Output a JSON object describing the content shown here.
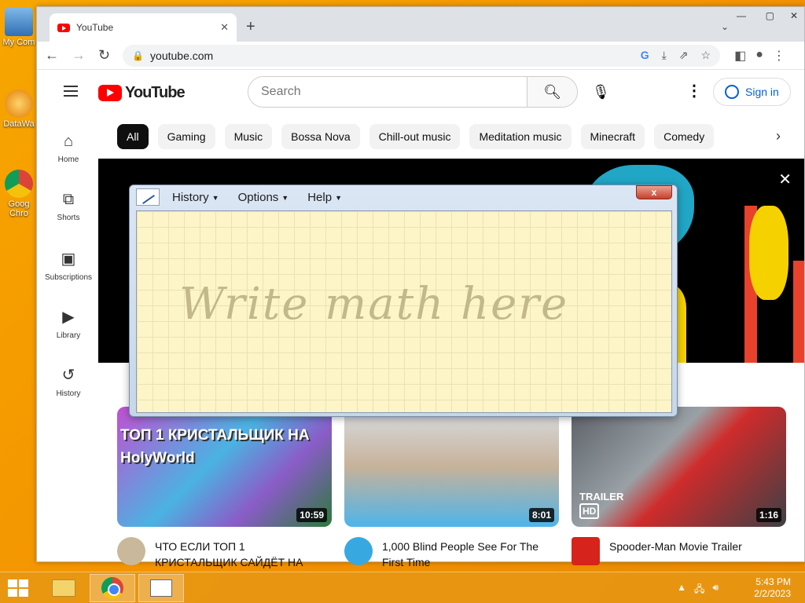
{
  "desktop": {
    "icons": [
      {
        "label": "My Com"
      },
      {
        "label": "DataWa"
      },
      {
        "label": "Goog Chro"
      }
    ]
  },
  "browser": {
    "tab_title": "YouTube",
    "url": "youtube.com"
  },
  "youtube": {
    "logo_text": "YouTube",
    "search_placeholder": "Search",
    "sign_in": "Sign in",
    "sidebar": [
      {
        "label": "Home",
        "icon": "home-icon"
      },
      {
        "label": "Shorts",
        "icon": "shorts-icon"
      },
      {
        "label": "Subscriptions",
        "icon": "subscriptions-icon"
      },
      {
        "label": "Library",
        "icon": "library-icon"
      },
      {
        "label": "History",
        "icon": "history-icon"
      }
    ],
    "chips": [
      "All",
      "Gaming",
      "Music",
      "Bossa Nova",
      "Chill-out music",
      "Meditation music",
      "Minecraft",
      "Comedy"
    ],
    "videos": [
      {
        "title": "ЧТО ЕСЛИ ТОП 1 КРИСТАЛЬЩИК САЙДЁТ НА",
        "duration": "10:59",
        "thumb_text": "ТОП 1 КРИСТАЛЬЩИК НА HolyWorld"
      },
      {
        "title": "1,000 Blind People See For The First Time",
        "duration": "8:01"
      },
      {
        "title": "Spooder-Man Movie Trailer",
        "duration": "1:16",
        "thumb_text": "TRAILER",
        "badge": "HD"
      }
    ]
  },
  "math_input_panel": {
    "menu": [
      "History",
      "Options",
      "Help"
    ],
    "close_label": "x",
    "hint": "Write math here"
  },
  "taskbar": {
    "time": "5:43 PM",
    "date": "2/2/2023"
  },
  "colors": {
    "yt_red": "#ff0000",
    "link_blue": "#065fd4",
    "desktop_orange": "#f39200"
  }
}
